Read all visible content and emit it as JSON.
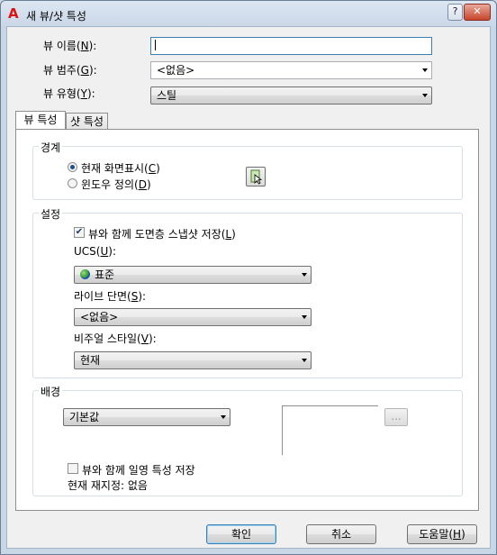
{
  "window": {
    "title": "새 뷰/샷 특성",
    "help_label": "?",
    "close_label": "✕"
  },
  "top_fields": {
    "view_name_label": "뷰 이름(",
    "view_name_key": "N",
    "view_name_suffix": "):",
    "view_name_value": "",
    "view_category_label": "뷰 범주(",
    "view_category_key": "G",
    "view_category_suffix": "):",
    "view_category_value": "<없음>",
    "view_type_label": "뷰 유형(",
    "view_type_key": "Y",
    "view_type_suffix": "):",
    "view_type_value": "스틸"
  },
  "tabs": [
    {
      "label": "뷰 특성",
      "active": true
    },
    {
      "label": "샷 특성",
      "active": false
    }
  ],
  "boundary": {
    "title": "경계",
    "current_display_label": "현재 화면표시(",
    "current_display_key": "C",
    "current_display_suffix": ")",
    "define_window_label": "윈도우 정의(",
    "define_window_key": "D",
    "define_window_suffix": ")",
    "selected": "current_display"
  },
  "settings": {
    "title": "설정",
    "save_layer_snapshot_label": "뷰와 함께 도면층 스냅샷 저장(",
    "save_layer_snapshot_key": "L",
    "save_layer_snapshot_suffix": ")",
    "save_layer_snapshot_checked": true,
    "ucs_label": "UCS(",
    "ucs_key": "U",
    "ucs_suffix": "):",
    "ucs_value": "표준",
    "live_section_label": "라이브 단면(",
    "live_section_key": "S",
    "live_section_suffix": "):",
    "live_section_value": "<없음>",
    "visual_style_label": "비주얼 스타일(",
    "visual_style_key": "V",
    "visual_style_suffix": "):",
    "visual_style_value": "현재"
  },
  "background": {
    "title": "배경",
    "type_value": "기본값",
    "browse_label": "...",
    "save_sun_label": "뷰와 함께 일영 특성 저장",
    "save_sun_checked": false,
    "current_override_label": "현재 재지정: 없음"
  },
  "buttons": {
    "ok_label": "확인",
    "cancel_label": "취소",
    "help_label": "도움말(",
    "help_key": "H",
    "help_suffix": ")"
  }
}
